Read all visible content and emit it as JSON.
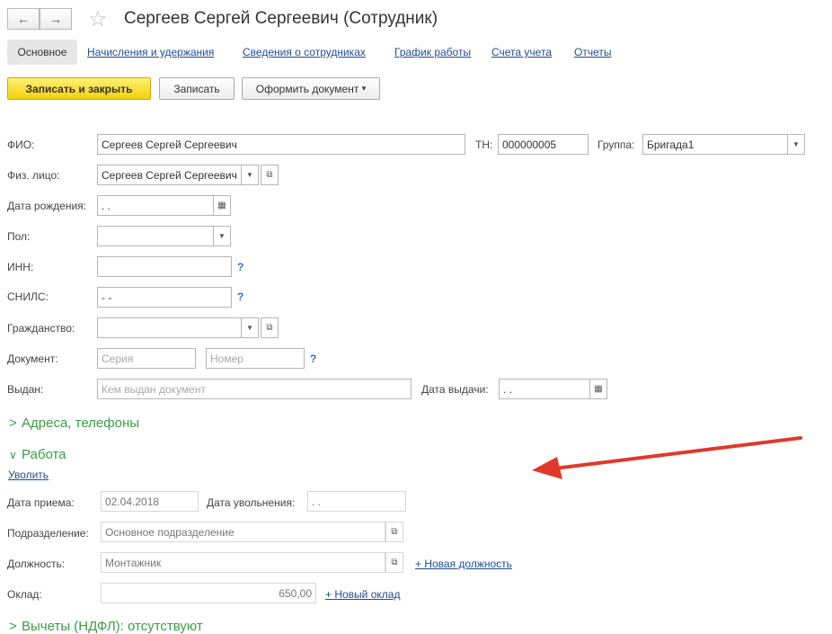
{
  "window": {
    "title": "Сергеев Сергей Сергеевич (Сотрудник)",
    "back_icon": "←",
    "forward_icon": "→"
  },
  "tabs": [
    {
      "label": "Основное"
    },
    {
      "label": "Начисления и удержания"
    },
    {
      "label": "Сведения о сотрудниках"
    },
    {
      "label": "График работы"
    },
    {
      "label": "Счета учета"
    },
    {
      "label": "Отчеты"
    }
  ],
  "toolbar": {
    "save_close": "Записать и закрыть",
    "save": "Записать",
    "document": "Оформить документ",
    "document_arrow": "▾"
  },
  "form": {
    "fio_label": "ФИО:",
    "fio_value": "Сергеев Сергей Сергеевич",
    "tn_label": "ТН:",
    "tn_value": "000000005",
    "group_label": "Группа:",
    "group_value": "Бригада1",
    "person_label": "Физ. лицо:",
    "person_value": "Сергеев Сергей Сергеевич",
    "birth_label": "Дата рождения:",
    "birth_value": " .  .",
    "gender_label": "Пол:",
    "gender_value": "",
    "inn_label": "ИНН:",
    "inn_value": "",
    "snils_label": "СНИЛС:",
    "snils_value": "   -   -",
    "citizenship_label": "Гражданство:",
    "citizenship_value": "",
    "doc_label": "Документ:",
    "doc_series_placeholder": "Серия",
    "doc_number_placeholder": "Номер",
    "issued_label": "Выдан:",
    "issued_placeholder": "Кем выдан документ",
    "issue_date_label": "Дата выдачи:",
    "issue_date_value": " .  .",
    "help": "?"
  },
  "sections": {
    "addresses": "Адреса, телефоны",
    "work": "Работа",
    "expand_icon": ">",
    "collapse_icon": "∨",
    "bottom_partial": "Вычеты (НДФЛ): отсутствуют"
  },
  "work": {
    "dismiss_link": "Уволить",
    "hire_label": "Дата приема:",
    "hire_value": "02.04.2018",
    "dismiss_label": "Дата увольнения:",
    "dismiss_value": " .  .",
    "dept_label": "Подразделение:",
    "dept_value": "Основное подразделение",
    "position_label": "Должность:",
    "position_value": "Монтажник",
    "new_position": "+ Новая должность",
    "salary_label": "Оклад:",
    "salary_value": "650,00",
    "new_salary": "+ Новый оклад"
  },
  "annotation_color": "#e0392b"
}
